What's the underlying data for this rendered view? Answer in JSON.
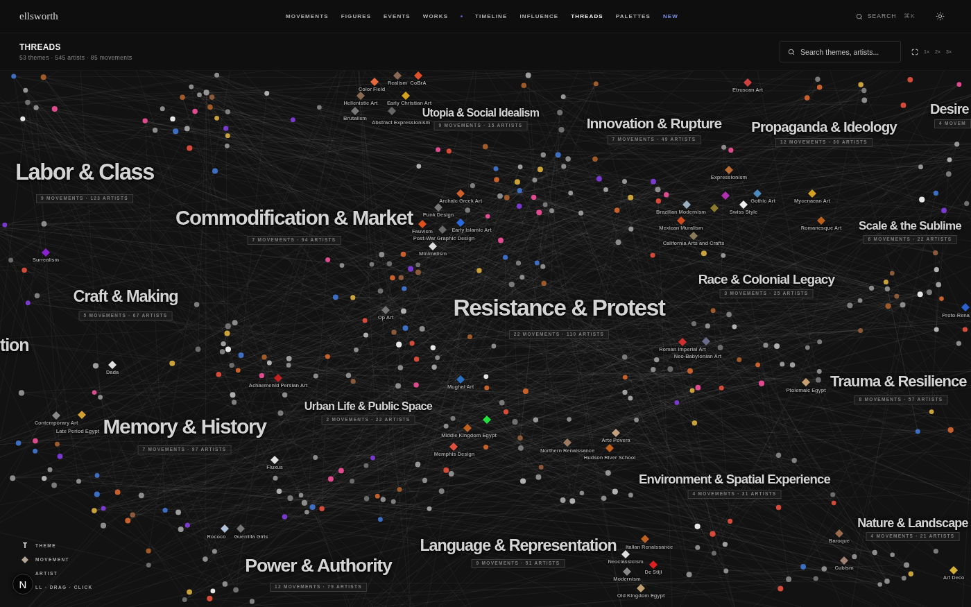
{
  "header": {
    "logo": "ellsworth",
    "nav": {
      "primary": [
        {
          "label": "MOVEMENTS",
          "kind": "link",
          "selected": false
        },
        {
          "label": "FIGURES",
          "kind": "link",
          "selected": false
        },
        {
          "label": "EVENTS",
          "kind": "link",
          "selected": false
        },
        {
          "label": "WORKS",
          "kind": "link",
          "selected": false
        }
      ],
      "secondary": [
        {
          "label": "TIMELINE",
          "kind": "link",
          "selected": false
        },
        {
          "label": "INFLUENCE",
          "kind": "link",
          "selected": false
        },
        {
          "label": "THREADS",
          "kind": "link",
          "selected": true
        },
        {
          "label": "PALETTES",
          "kind": "link",
          "selected": false
        },
        {
          "label": "NEW",
          "kind": "new",
          "selected": false
        }
      ]
    },
    "search": {
      "label": "SEARCH",
      "shortcut": "⌘K"
    }
  },
  "page": {
    "title": "THREADS",
    "summary": "53 themes · 545 artists · 85 movements"
  },
  "toolbar": {
    "search": {
      "placeholder": "Search themes, artists..."
    },
    "zoom": [
      {
        "label": "1×",
        "selected": false
      },
      {
        "label": "2×",
        "selected": false
      },
      {
        "label": "3×",
        "selected": false
      }
    ]
  },
  "themes": [
    {
      "title": "Utopia & Social Idealism",
      "stats": "9 MOVEMENTS · 15 ARTISTS"
    },
    {
      "title": "Innovation & Rupture",
      "stats": "7 MOVEMENTS · 49 ARTISTS"
    },
    {
      "title": "Propaganda & Ideology",
      "stats": "12 MOVEMENTS · 30 ARTISTS"
    },
    {
      "title": "Desire",
      "stats": "4 MOVEM"
    },
    {
      "title": "Labor & Class",
      "stats": "9 MOVEMENTS · 123 ARTISTS"
    },
    {
      "title": "Commodification & Market",
      "stats": "7 MOVEMENTS · 94 ARTISTS"
    },
    {
      "title": "Scale & the Sublime",
      "stats": "6 MOVEMENTS · 22 ARTISTS"
    },
    {
      "title": "Race & Colonial Legacy",
      "stats": "3 MOVEMENTS · 25 ARTISTS"
    },
    {
      "title": "Craft & Making",
      "stats": "5 MOVEMENTS · 67 ARTISTS"
    },
    {
      "title": "Resistance & Protest",
      "stats": "22 MOVEMENTS · 110 ARTISTS"
    },
    {
      "title": "tion"
    },
    {
      "title": "Trauma & Resilience",
      "stats": "8 MOVEMENTS · 57 ARTISTS"
    },
    {
      "title": "Urban Life & Public Space",
      "stats": "2 MOVEMENTS · 22 ARTISTS"
    },
    {
      "title": "Memory & History",
      "stats": "7 MOVEMENTS · 97 ARTISTS"
    },
    {
      "title": "Environment & Spatial Experience",
      "stats": "4 MOVEMENTS · 31 ARTISTS"
    },
    {
      "title": "Nature & Landscape",
      "stats": "4 MOVEMENTS · 21 ARTISTS"
    },
    {
      "title": "Language & Representation",
      "stats": "9 MOVEMENTS · 51 ARTISTS"
    },
    {
      "title": "Power & Authority",
      "stats": "12 MOVEMENTS · 79 ARTISTS"
    }
  ],
  "movements": [
    {
      "label": "Realism",
      "color": "#8a6a55"
    },
    {
      "label": "CoBrA",
      "color": "#e0502a"
    },
    {
      "label": "Color Field",
      "color": "#e8683a"
    },
    {
      "label": "Etruscan Art",
      "color": "#d04040"
    },
    {
      "label": "Hellenistic Art",
      "color": "#8a6a50"
    },
    {
      "label": "Early Christian Art",
      "color": "#d4a020"
    },
    {
      "label": "Brutalism",
      "color": "#777777"
    },
    {
      "label": "Abstract Expressionism",
      "color": "#666666"
    },
    {
      "label": "Expressionism",
      "color": "#b86a30"
    },
    {
      "label": "Archaic Greek Art",
      "color": "#d0602a"
    },
    {
      "color": "#b030b0"
    },
    {
      "label": "Gothic Art",
      "color": "#4a8ac0"
    },
    {
      "label": "Mycenaean Art",
      "color": "#d4a020"
    },
    {
      "label": "Punk Design",
      "color": "#777777"
    },
    {
      "label": "Brazilian Modernism",
      "color": "#9ab0c0"
    },
    {
      "color": "#8a7a30"
    },
    {
      "label": "Swiss Style",
      "color": "#eeeeee"
    },
    {
      "label": "Fauvism",
      "color": "#e0501a"
    },
    {
      "label": "Early Islamic Art",
      "color": "#2a6ae0"
    },
    {
      "label": "Mexican Muralism",
      "color": "#d04a1a"
    },
    {
      "label": "Romanesque Art",
      "color": "#b8601a"
    },
    {
      "label": "Post-War Graphic Design",
      "color": "#6a6a6a"
    },
    {
      "label": "California Arts and Crafts",
      "color": "#8a7a5a"
    },
    {
      "label": "Minimalism",
      "color": "#dddddd"
    },
    {
      "label": "Surrealism",
      "color": "#8a20d0"
    },
    {
      "label": "Op Art",
      "color": "#777777"
    },
    {
      "label": "Proto-Rena",
      "color": "#2a60d0"
    },
    {
      "label": "Roman Imperial Art",
      "color": "#d03030"
    },
    {
      "label": "Neo-Babylonian Art",
      "color": "#6a6a8a"
    },
    {
      "label": "Dada",
      "color": "#e0e0e0"
    },
    {
      "label": "Achaemenid Persian Art",
      "color": "#c02020"
    },
    {
      "label": "Mughal Art",
      "color": "#2a70c0"
    },
    {
      "label": "Ptolemaic Egypt",
      "color": "#c8a070"
    },
    {
      "label": "Contemporary Art",
      "color": "#888888"
    },
    {
      "color": "#20e040"
    },
    {
      "label": "Late Period Egypt",
      "color": "#d0a030"
    },
    {
      "label": "Middle Kingdom Egypt",
      "color": "#c06020"
    },
    {
      "label": "Arte Povera",
      "color": "#c0a080"
    },
    {
      "label": "Memphis Design",
      "color": "#e05040"
    },
    {
      "label": "Northern Renaissance",
      "color": "#9a7a60"
    },
    {
      "label": "Hudson River School",
      "color": "#c0601a"
    },
    {
      "label": "Fluxus",
      "color": "#e0e0e0"
    },
    {
      "label": "Rococo",
      "color": "#b0c0d8"
    },
    {
      "label": "Guerrilla Girls",
      "color": "#777777"
    },
    {
      "label": "Baroque",
      "color": "#9a6a4a"
    },
    {
      "label": "Italian Renaissance",
      "color": "#c06020"
    },
    {
      "label": "Neoclassicism",
      "color": "#dddddd"
    },
    {
      "label": "De Stijl",
      "color": "#e02020"
    },
    {
      "label": "Cubism",
      "color": "#a08070"
    },
    {
      "label": "Modernism",
      "color": "#888888"
    },
    {
      "label": "Art Deco",
      "color": "#d4b030"
    },
    {
      "label": "Old Kingdom Egypt",
      "color": "#c0a070"
    }
  ],
  "legend": {
    "items": [
      {
        "symbol": "T",
        "label": "THEME",
        "kind": "letter"
      },
      {
        "label": "MOVEMENT",
        "kind": "diamond"
      },
      {
        "label": "ARTIST"
      }
    ],
    "hint": "LL · DRAG · CLICK"
  },
  "dev_badge": {
    "letter": "N"
  }
}
